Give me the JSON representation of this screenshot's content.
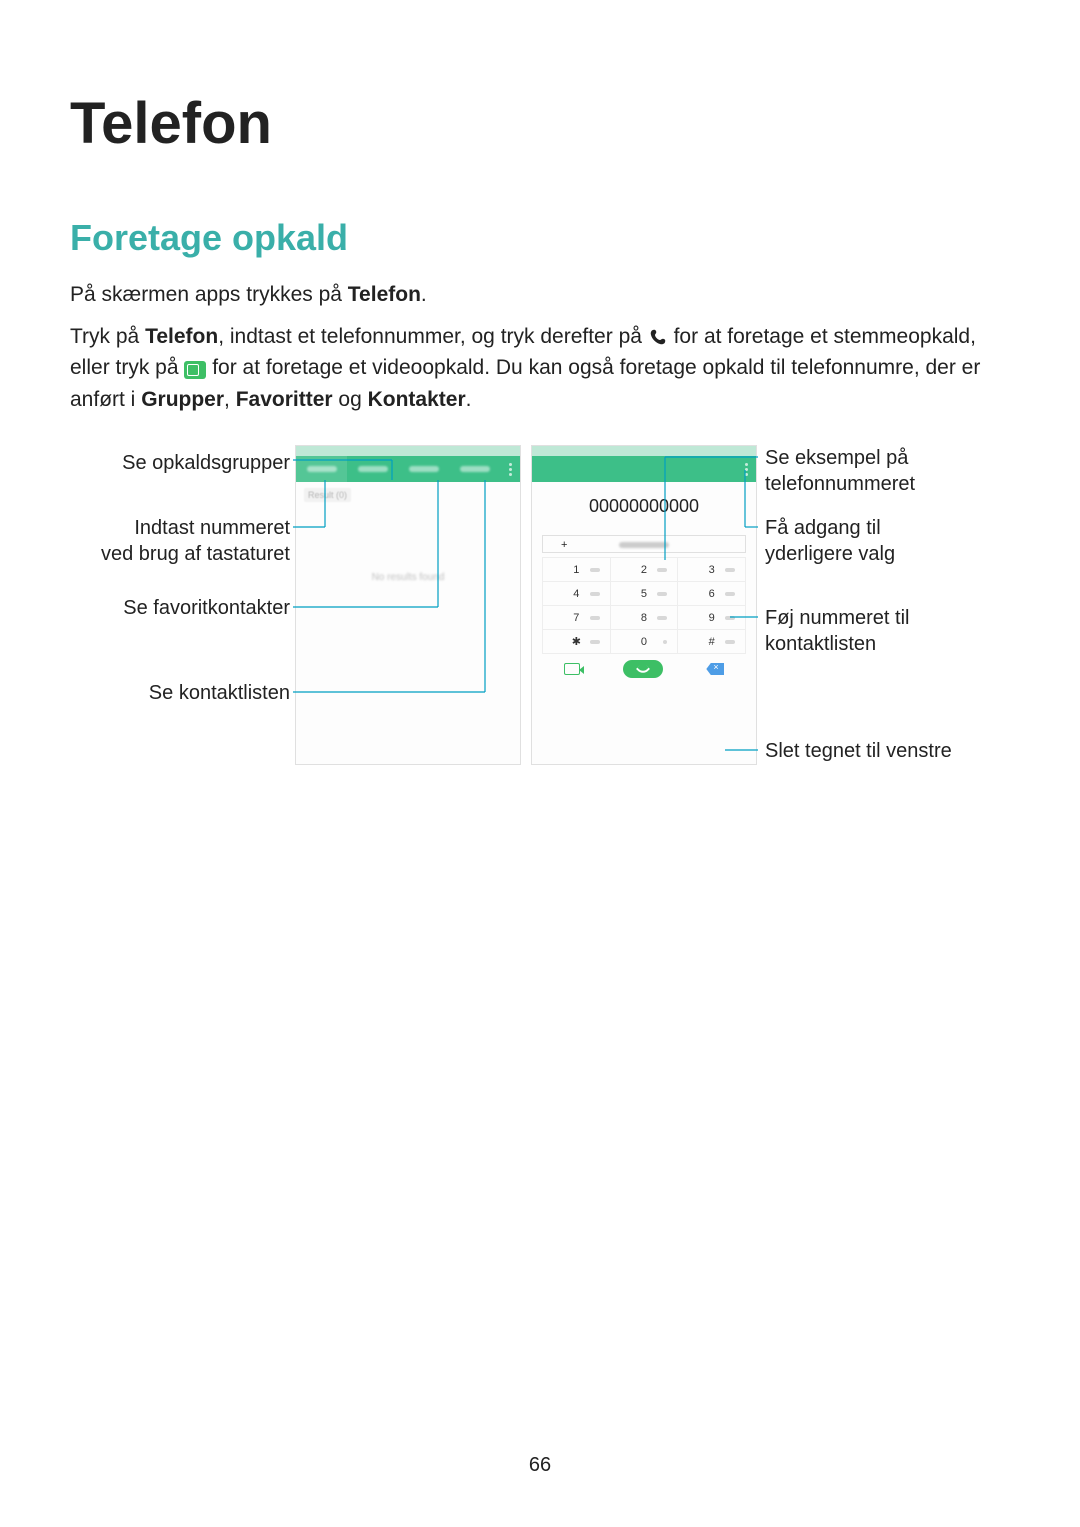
{
  "page_number": "66",
  "title": "Telefon",
  "section_heading": "Foretage opkald",
  "intro_line_prefix": "På skærmen apps trykkes på ",
  "intro_line_bold": "Telefon",
  "intro_line_suffix": ".",
  "body_part1": "Tryk på ",
  "body_bold1": "Telefon",
  "body_part2": ", indtast et telefonnummer, og tryk derefter på ",
  "body_part3": " for at foretage et stemmeopkald, eller tryk på ",
  "body_part4": " for at foretage et videoopkald. Du kan også foretage opkald til telefonnumre, der er anført i ",
  "body_bold2": "Grupper",
  "body_sep1": ", ",
  "body_bold3": "Favoritter",
  "body_sep2": " og ",
  "body_bold4": "Kontakter",
  "body_end": ".",
  "callouts": {
    "left1": "Se opkaldsgrupper",
    "left2a": "Indtast nummeret",
    "left2b": "ved brug af tastaturet",
    "left3": "Se favoritkontakter",
    "left4": "Se kontaktlisten",
    "right1a": "Se eksempel på",
    "right1b": "telefonnummeret",
    "right2a": "Få adgang til",
    "right2b": "yderligere valg",
    "right3a": "Føj nummeret til",
    "right3b": "kontaktlisten",
    "right4": "Slet tegnet til venstre"
  },
  "phone": {
    "number_display": "00000000000",
    "keys": [
      "1",
      "2",
      "3",
      "4",
      "5",
      "6",
      "7",
      "8",
      "9",
      "✱",
      "0",
      "#"
    ]
  }
}
